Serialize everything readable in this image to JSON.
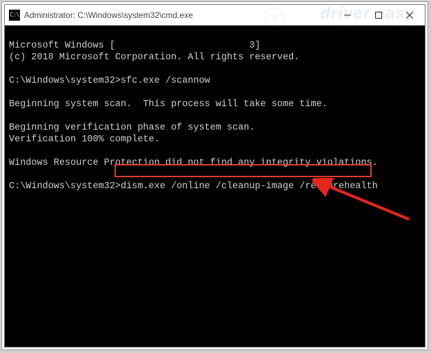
{
  "window": {
    "title": "Administrator: C:\\Windows\\system32\\cmd.exe",
    "icon_name": "cmd-icon",
    "icon_glyph": "C:\\"
  },
  "terminal": {
    "lines": {
      "l0": "Microsoft Windows [                        3]",
      "l1": "(c) 2018 Microsoft Corporation. All rights reserved.",
      "l2": "",
      "l3_prefix": "C:\\Windows\\system32>",
      "l3_cmd": "sfc.exe /scannow",
      "l4": "",
      "l5": "Beginning system scan.  This process will take some time.",
      "l6": "",
      "l7": "Beginning verification phase of system scan.",
      "l8": "Verification 100% complete.",
      "l9": "",
      "l10": "Windows Resource Protection did not find any integrity violations.",
      "l11": "",
      "l12_prefix": "C:\\Windows\\system32>",
      "l12_cmd": "dism.exe /online /cleanup-image /restorehealth"
    }
  },
  "annotation": {
    "highlight_color": "#e13b31",
    "arrow_color": "#e8261b"
  },
  "watermark": {
    "title": "driver easy",
    "url": "www.DriverEasy.com"
  }
}
